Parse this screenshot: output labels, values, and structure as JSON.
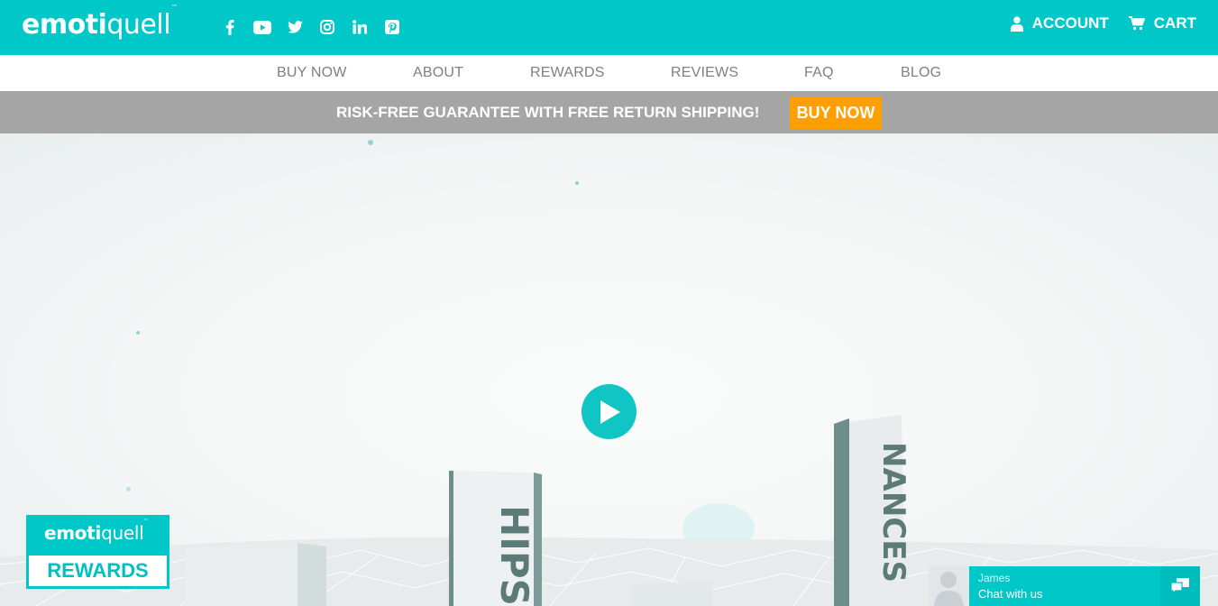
{
  "brand": {
    "part1": "emoti",
    "part2": "quell",
    "tm": "™"
  },
  "social": [
    "facebook-icon",
    "youtube-icon",
    "twitter-icon",
    "instagram-icon",
    "linkedin-icon",
    "pinterest-icon"
  ],
  "header": {
    "account_label": "ACCOUNT",
    "cart_label": "CART"
  },
  "nav": {
    "items": [
      "BUY NOW",
      "ABOUT",
      "REWARDS",
      "REVIEWS",
      "FAQ",
      "BLOG"
    ]
  },
  "promo": {
    "text": "RISK-FREE GUARANTEE WITH FREE RETURN SHIPPING!",
    "button": "BUY NOW"
  },
  "hero": {
    "pillar_left_text": "HIPS",
    "pillar_right_text": "NANCES"
  },
  "rewards": {
    "label": "REWARDS"
  },
  "chat": {
    "agent_name": "James",
    "cta": "Chat with us"
  },
  "colors": {
    "teal": "#00c8c8",
    "orange": "#ffa000",
    "gray_banner": "#a5a5a5",
    "nav_text": "#7f7f7f"
  }
}
